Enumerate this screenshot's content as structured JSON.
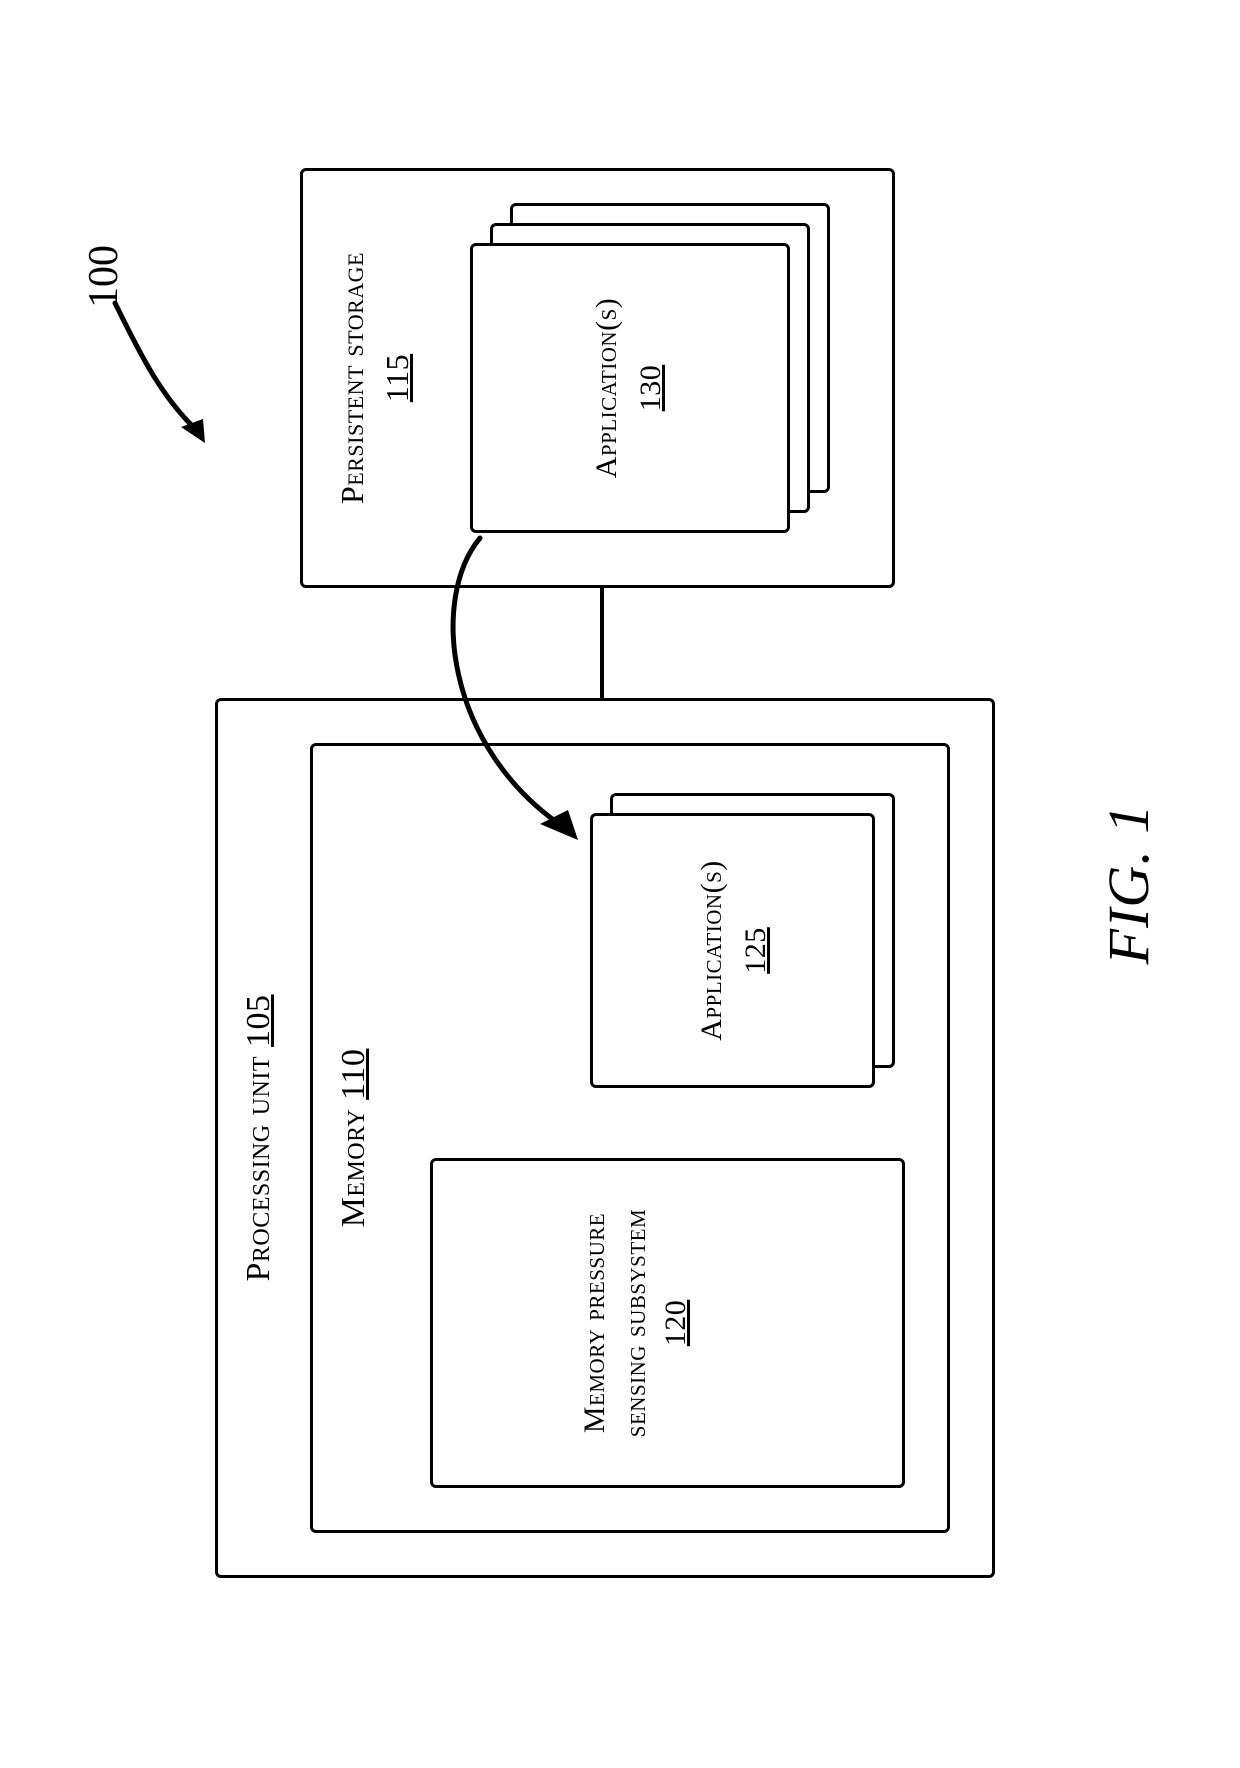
{
  "figure_number": "100",
  "figure_label": "FIG. 1",
  "processing_unit": {
    "title": "Processing unit",
    "ref": "105"
  },
  "memory": {
    "title": "Memory",
    "ref": "110"
  },
  "memory_pressure": {
    "title_line1": "Memory pressure",
    "title_line2": "sensing subsystem",
    "ref": "120"
  },
  "apps_memory": {
    "title": "Application(s)",
    "ref": "125"
  },
  "persistent_storage": {
    "title": "Persistent storage",
    "ref": "115"
  },
  "apps_storage": {
    "title": "Application(s)",
    "ref": "130"
  }
}
